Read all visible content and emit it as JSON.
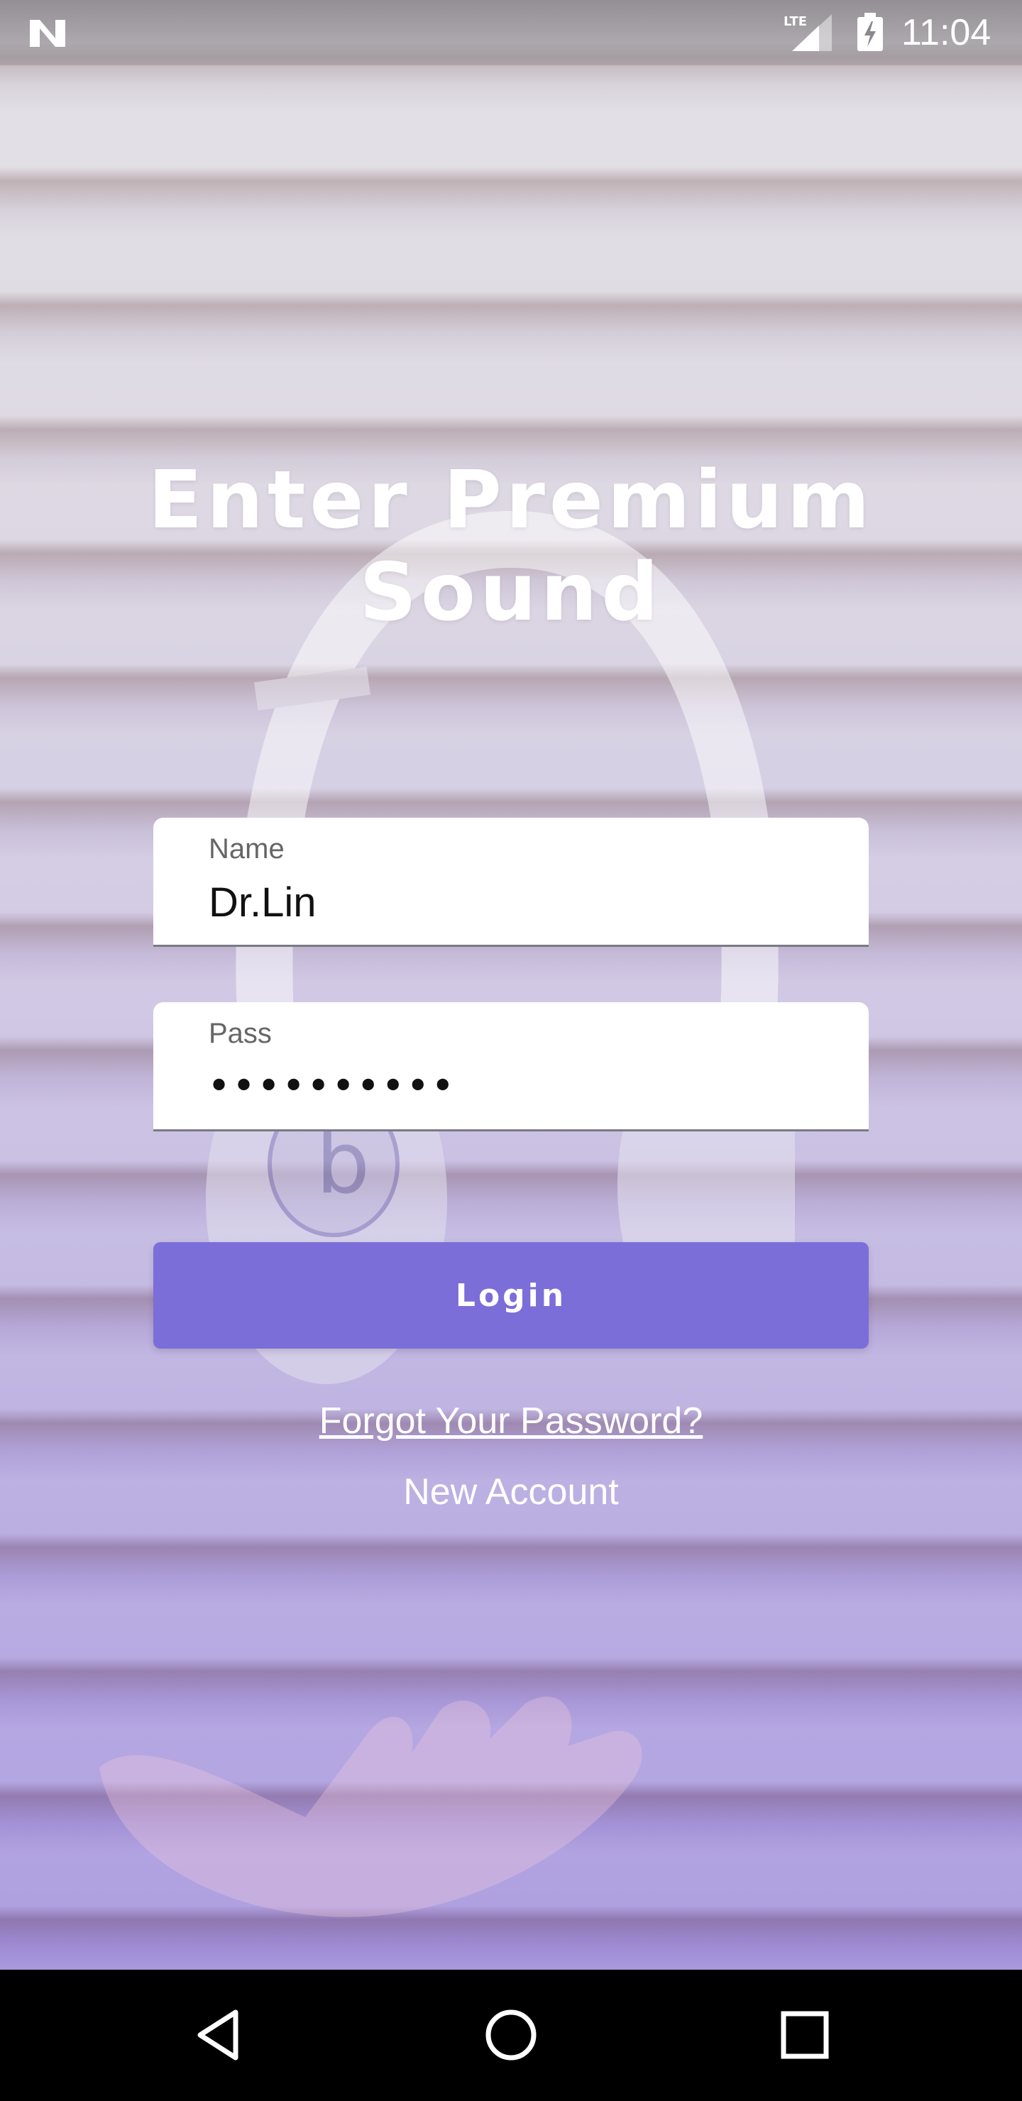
{
  "status_bar": {
    "time": "11:04",
    "network_label": "LTE",
    "icons": [
      "n-logo-icon",
      "lte-signal-icon",
      "battery-charging-icon"
    ]
  },
  "title": "Enter Premium Sound",
  "form": {
    "name": {
      "label": "Name",
      "value": "Dr.Lin"
    },
    "pass": {
      "label": "Pass",
      "value": "••••••••••"
    }
  },
  "login_label": "Login",
  "forgot_label": "Forgot Your Password?",
  "new_account_label": "New Account",
  "nav_bar": {
    "icons": [
      "back-icon",
      "home-icon",
      "recents-icon"
    ]
  },
  "colors": {
    "accent": "#7b6ed8",
    "text_on_bg": "#ffffff",
    "field_bg": "#ffffff"
  }
}
